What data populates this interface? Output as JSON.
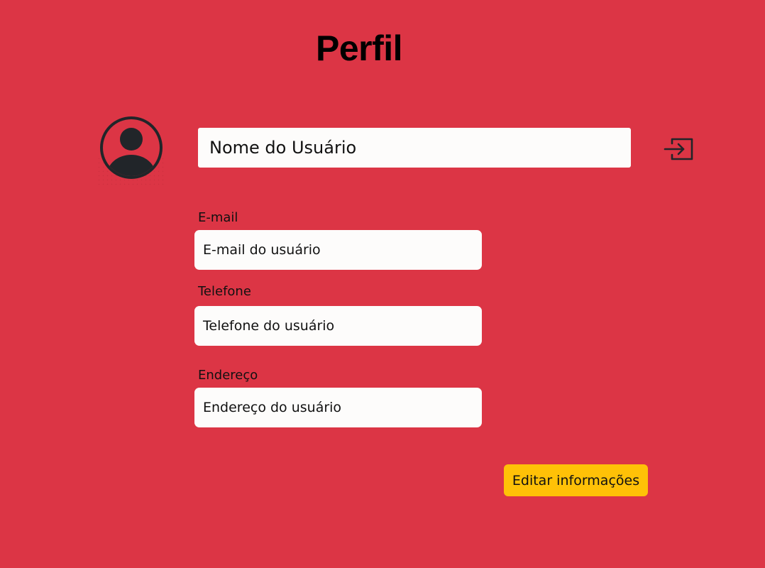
{
  "page": {
    "title": "Perfil"
  },
  "profile": {
    "avatar_icon": "user-circle-icon",
    "name_value": "Nome do Usuário",
    "logout_icon": "logout-icon"
  },
  "fields": {
    "email": {
      "label": "E-mail",
      "value": "E-mail do usuário"
    },
    "phone": {
      "label": "Telefone",
      "value": "Telefone do usuário"
    },
    "address": {
      "label": "Endereço",
      "value": "Endereço do usuário"
    }
  },
  "actions": {
    "edit_label": "Editar informações"
  },
  "colors": {
    "background": "#dc3545",
    "field_background": "#fdfcfb",
    "button_background": "#ffc107",
    "icon": "#212529"
  }
}
